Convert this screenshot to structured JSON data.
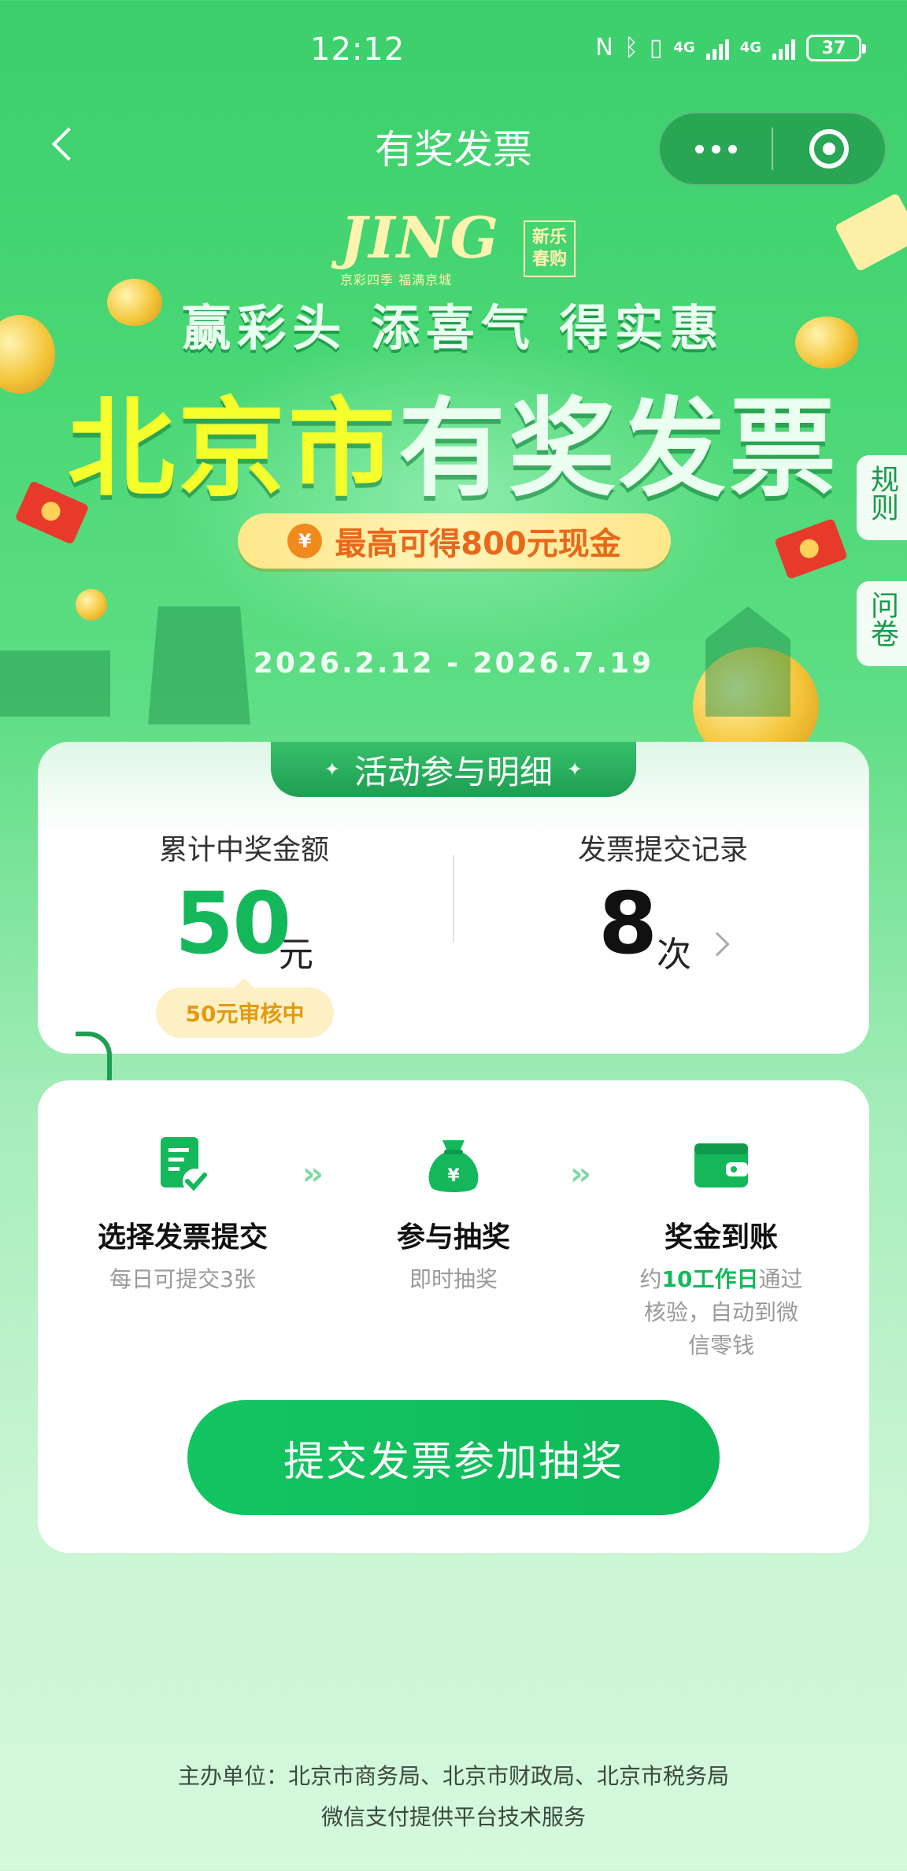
{
  "status_bar": {
    "time": "12:12",
    "network_1": "4G",
    "network_2": "4G",
    "battery": "37",
    "signal_level": 1.0
  },
  "nav": {
    "title": "有奖发票",
    "back_icon": "chevron-left-icon",
    "more_icon": "more-dots-icon",
    "close_icon": "target-close-icon"
  },
  "hero": {
    "logo_text": "JING",
    "logo_sub": "京彩四季 福满京城",
    "seal_text": "新乐\n春购",
    "slogan": "赢彩头 添喜气 得实惠",
    "title_yellow": "北京市",
    "title_white": "有奖发票",
    "max_prize": "最高可得800元现金",
    "yen_symbol": "¥",
    "dates": "2026.2.12 - 2026.7.19"
  },
  "side_tabs": {
    "rules": "规则",
    "survey": "问卷"
  },
  "detail": {
    "tab_title": "活动参与明细",
    "prize_label": "累计中奖金额",
    "prize_amount": "50",
    "prize_unit": "元",
    "review_status": "50元审核中",
    "record_label": "发票提交记录",
    "record_count": "8",
    "record_unit": "次"
  },
  "steps": [
    {
      "icon": "invoice-check-icon",
      "title": "选择发票提交",
      "desc": "每日可提交3张"
    },
    {
      "icon": "money-bag-icon",
      "title": "参与抽奖",
      "desc": "即时抽奖"
    },
    {
      "icon": "wallet-icon",
      "title": "奖金到账",
      "desc_prefix": "约",
      "desc_highlight": "10工作日",
      "desc_suffix": "通过核验，自动到微信零钱"
    }
  ],
  "cta": {
    "label": "提交发票参加抽奖"
  },
  "footer": {
    "organizer": "主办单位：北京市商务局、北京市财政局、北京市税务局",
    "tech": "微信支付提供平台技术服务"
  },
  "colors": {
    "brand_green": "#14b85b",
    "header_green": "#3ccf6c",
    "title_yellow": "#f4ff2c",
    "review_orange": "#e29a10"
  }
}
